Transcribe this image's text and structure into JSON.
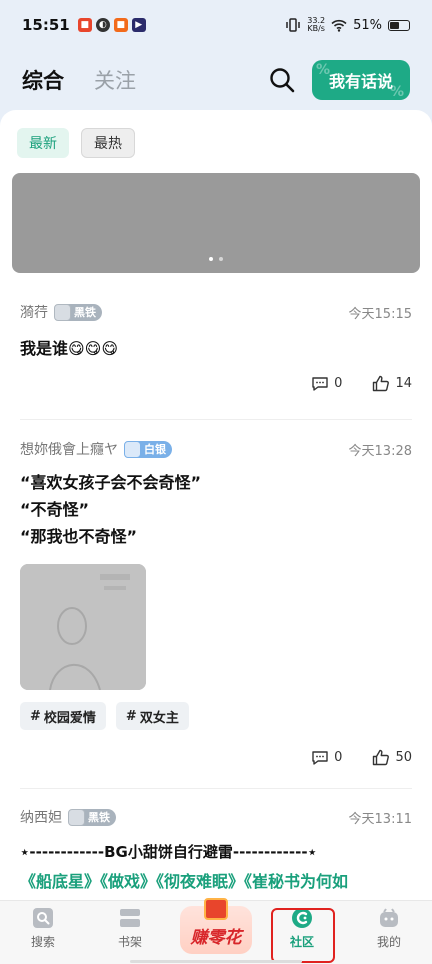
{
  "status_bar": {
    "time": "15:51",
    "net_speed_value": "33.2",
    "net_speed_unit": "KB/s",
    "battery": "51%"
  },
  "header": {
    "tab_main": "综合",
    "tab_follow": "关注",
    "post_button": "我有话说"
  },
  "filters": [
    {
      "label": "最新",
      "active": true
    },
    {
      "label": "最热",
      "active": false
    }
  ],
  "posts": [
    {
      "author": "漪荇",
      "badge": "黑铁",
      "time": "今天15:15",
      "text": "我是谁😋😋😋",
      "comments": "0",
      "likes": "14"
    },
    {
      "author": "想妳俄會上癮ヤ",
      "badge": "白银",
      "time": "今天13:28",
      "lines": [
        "“喜欢女孩子会不会奇怪”",
        "“不奇怪”",
        "“那我也不奇怪”"
      ],
      "tags": [
        "校园爱情",
        "双女主"
      ],
      "comments": "0",
      "likes": "50"
    },
    {
      "author": "纳西妲",
      "badge": "黑铁",
      "time": "今天13:11",
      "title": "⋆------------BG小甜饼自行避雷------------⋆",
      "links": "《船底星》《做戏》《彻夜难眠》《崔秘书为何如"
    }
  ],
  "nav": {
    "search": "搜索",
    "shelf": "书架",
    "earn": "赚零花",
    "community": "社区",
    "mine": "我的"
  },
  "colors": {
    "accent": "#1eaa86",
    "highlight": "#e0221f"
  }
}
